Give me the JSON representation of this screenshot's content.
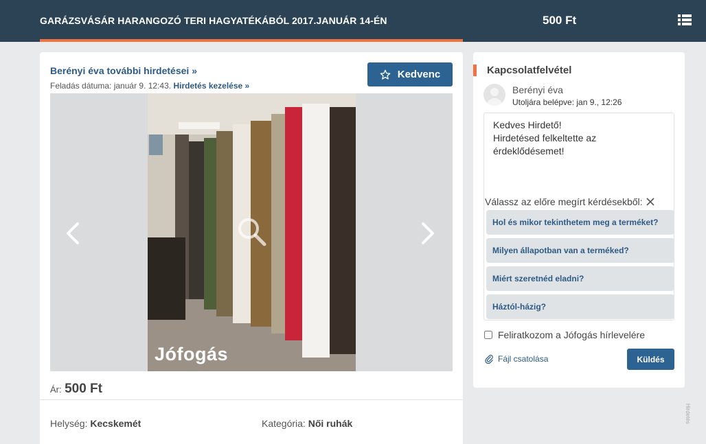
{
  "header": {
    "title": "GARÁZSVÁSÁR HARANGOZÓ TERI HAGYATÉKÁBÓL 2017.JANUÁR 14-ÉN",
    "price": "500 Ft",
    "menu_icon": "list-icon",
    "scroll_progress": 1.0
  },
  "listing": {
    "seller_link": "Berényi éva további hirdetései »",
    "posted_label": "Feladás dátuma: január 9. 12:43.",
    "manage_link": "Hirdetés kezelése »",
    "favorite_label": "Kedvenc",
    "watermark": "Jófogás",
    "price_label": "Ár:",
    "price_value": "500 Ft",
    "location_label": "Helység:",
    "location_value": "Kecskemét",
    "category_label": "Kategória:",
    "category_value": "Női ruhák"
  },
  "contact": {
    "title": "Kapcsolatfelvétel",
    "seller_name": "Berényi éva",
    "last_login": "Utoljára belépve: jan 9., 12:26",
    "message": "Kedves Hirdető!\nHirdetésed felkeltette az érdeklődésemet!",
    "preset_label": "Válassz az előre megírt kérdésekből:",
    "presets": [
      "Hol és mikor tekinthetem meg a terméket?",
      "Milyen állapotban van a terméked?",
      "Miért szeretnéd eladni?",
      "Háztól-házig?"
    ],
    "newsletter_label": "Feliratkozom a Jófogás hírlevelére",
    "attach_label": "Fájl csatolása",
    "send_label": "Küldés"
  },
  "sidebar_ad_label": "Hirdetés",
  "colors": {
    "header_bg": "#2c4356",
    "accent": "#f2713e",
    "primary_button": "#2d6393",
    "link": "#2d5b86"
  }
}
